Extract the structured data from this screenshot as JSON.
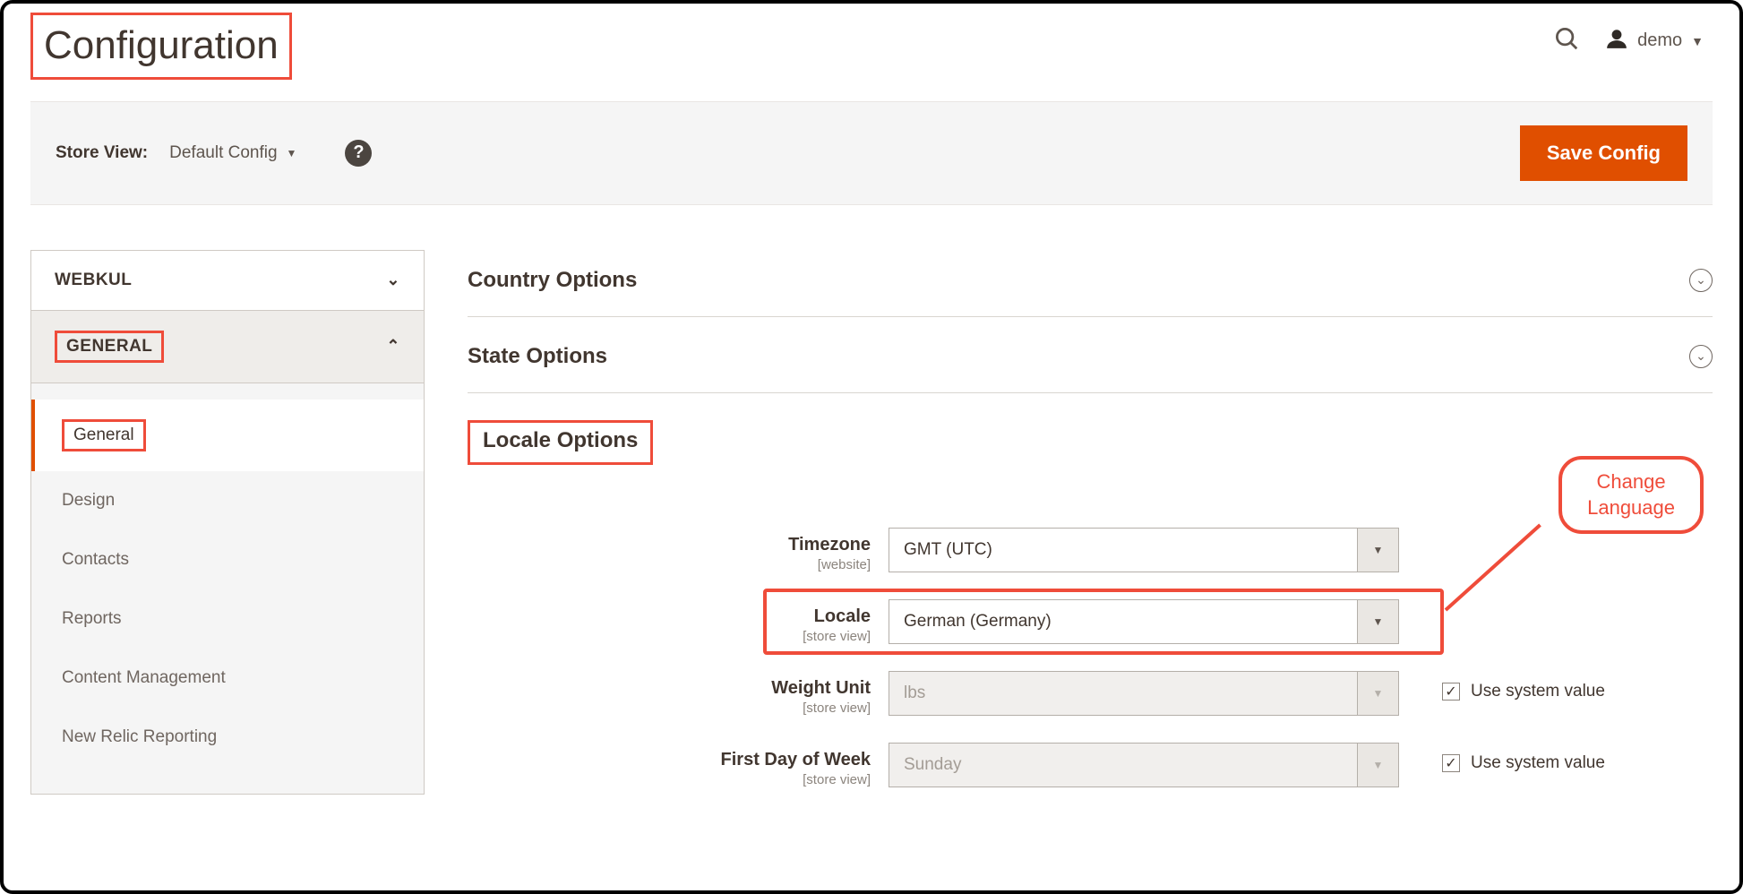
{
  "header": {
    "title": "Configuration",
    "user": "demo"
  },
  "toolbar": {
    "store_view_label": "Store View:",
    "store_view_value": "Default Config",
    "save_label": "Save Config"
  },
  "sidebar": {
    "groups": [
      {
        "label": "WEBKUL",
        "expanded": false
      },
      {
        "label": "GENERAL",
        "expanded": true
      }
    ],
    "items": [
      {
        "label": "General",
        "active": true
      },
      {
        "label": "Design"
      },
      {
        "label": "Contacts"
      },
      {
        "label": "Reports"
      },
      {
        "label": "Content Management"
      },
      {
        "label": "New Relic Reporting"
      }
    ]
  },
  "sections": {
    "country": "Country Options",
    "state": "State Options",
    "locale": "Locale Options"
  },
  "fields": {
    "timezone": {
      "label": "Timezone",
      "scope": "[website]",
      "value": "GMT (UTC)"
    },
    "locale": {
      "label": "Locale",
      "scope": "[store view]",
      "value": "German (Germany)"
    },
    "weight": {
      "label": "Weight Unit",
      "scope": "[store view]",
      "value": "lbs",
      "use_system": true
    },
    "firstday": {
      "label": "First Day of Week",
      "scope": "[store view]",
      "value": "Sunday",
      "use_system": true
    }
  },
  "labels": {
    "use_system": "Use system value"
  },
  "annotation": {
    "callout": "Change\nLanguage"
  }
}
